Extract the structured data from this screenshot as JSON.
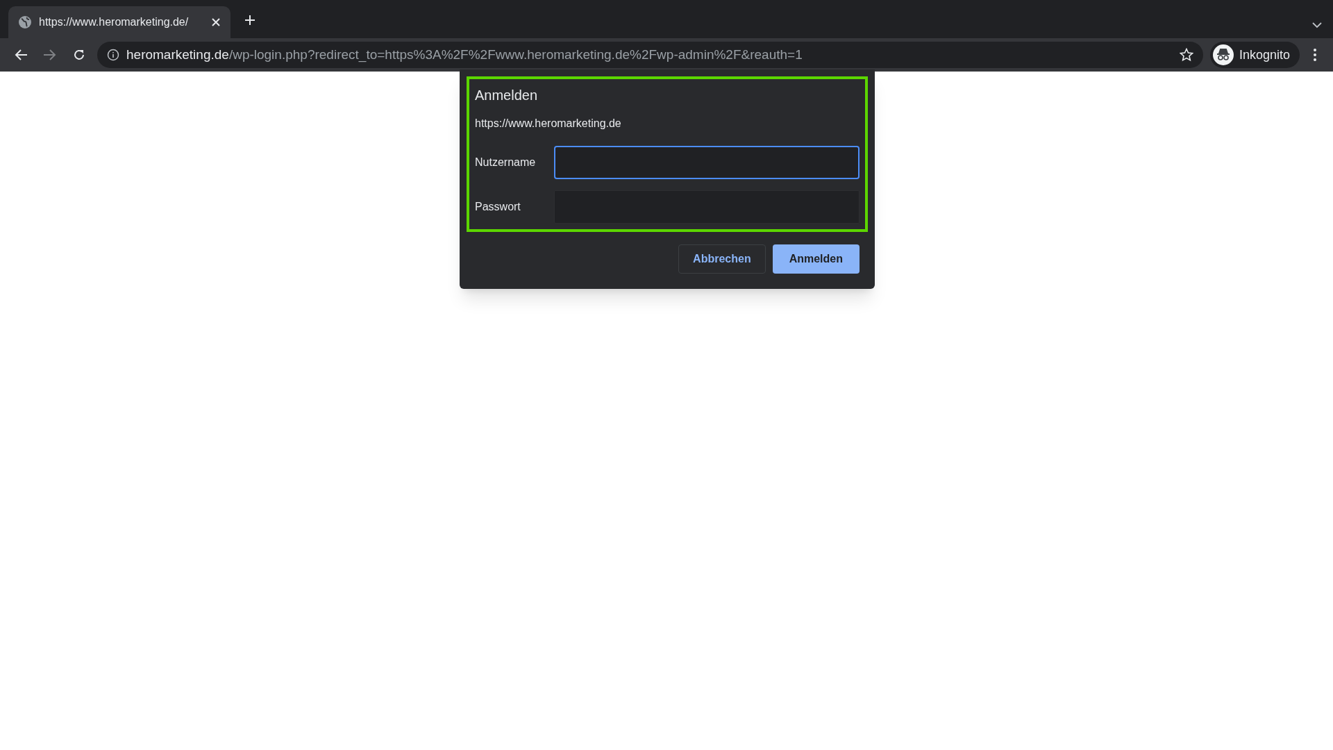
{
  "tabs": [
    {
      "title": "https://www.heromarketing.de/",
      "selected": true
    }
  ],
  "address_bar": {
    "host": "heromarketing.de",
    "path": "/wp-login.php?redirect_to=https%3A%2F%2Fwww.heromarketing.de%2Fwp-admin%2F&reauth=1"
  },
  "profile": {
    "label": "Inkognito"
  },
  "dialog": {
    "title": "Anmelden",
    "origin": "https://www.heromarketing.de",
    "fields": [
      {
        "label": "Nutzername",
        "focused": true
      },
      {
        "label": "Passwort",
        "focused": false
      }
    ],
    "buttons": [
      {
        "label": "Abbrechen",
        "kind": "secondary"
      },
      {
        "label": "Anmelden",
        "kind": "primary"
      }
    ]
  }
}
